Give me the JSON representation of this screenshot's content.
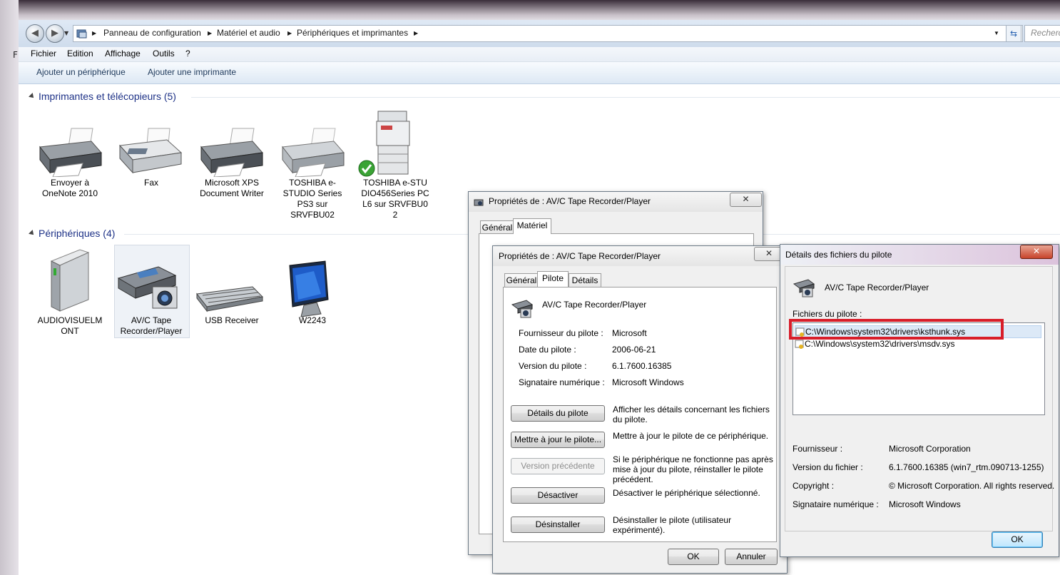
{
  "window": {
    "left_frame_letter": "F"
  },
  "addressbar": {
    "crumbs": [
      "Panneau de configuration",
      "Matériel et audio",
      "Périphériques et imprimantes"
    ],
    "search_placeholder": "Recherc"
  },
  "menu": [
    "Fichier",
    "Edition",
    "Affichage",
    "Outils",
    "?"
  ],
  "commands": [
    "Ajouter un périphérique",
    "Ajouter une imprimante"
  ],
  "groups": {
    "printers": {
      "title": "Imprimantes et télécopieurs (5)",
      "items": [
        {
          "label": "Envoyer à OneNote 2010",
          "icon": "printer-icon"
        },
        {
          "label": "Fax",
          "icon": "fax-icon"
        },
        {
          "label": "Microsoft XPS Document Writer",
          "icon": "printer-icon"
        },
        {
          "label": "TOSHIBA e-STUDIO Series PS3 sur SRVFBU02",
          "icon": "printer-icon"
        },
        {
          "label": "TOSHIBA e-STUDIO456Series PCL6 sur SRVFBU02",
          "icon": "copier-icon",
          "default": true
        }
      ]
    },
    "devices": {
      "title": "Périphériques (4)",
      "items": [
        {
          "label": "AUDIOVISUELMONT",
          "icon": "drive-icon"
        },
        {
          "label": "AV/C Tape Recorder/Player",
          "icon": "scanner-camera-icon",
          "selected": true
        },
        {
          "label": "USB Receiver",
          "icon": "keyboard-icon"
        },
        {
          "label": "W2243",
          "icon": "monitor-icon"
        }
      ]
    }
  },
  "dialog_back": {
    "title": "Propriétés de : AV/C Tape Recorder/Player",
    "tabs": [
      "Général",
      "Matériel"
    ],
    "close": "✕"
  },
  "dialog_driver": {
    "title": "Propriétés de : AV/C Tape Recorder/Player",
    "tabs": [
      "Général",
      "Pilote",
      "Détails"
    ],
    "device_name": "AV/C Tape Recorder/Player",
    "props": [
      {
        "label": "Fournisseur du pilote :",
        "value": "Microsoft"
      },
      {
        "label": "Date du pilote :",
        "value": "2006-06-21"
      },
      {
        "label": "Version du pilote :",
        "value": "6.1.7600.16385"
      },
      {
        "label": "Signataire numérique :",
        "value": "Microsoft Windows"
      }
    ],
    "actions": [
      {
        "button": "Détails du pilote",
        "desc": "Afficher les détails concernant les fichiers du pilote.",
        "enabled": true
      },
      {
        "button": "Mettre à jour le pilote...",
        "desc": "Mettre à jour le pilote de ce périphérique.",
        "enabled": true
      },
      {
        "button": "Version précédente",
        "desc": "Si le périphérique ne fonctionne pas après mise à jour du pilote, réinstaller le pilote précédent.",
        "enabled": false
      },
      {
        "button": "Désactiver",
        "desc": "Désactiver le périphérique sélectionné.",
        "enabled": true
      },
      {
        "button": "Désinstaller",
        "desc": "Désinstaller le pilote (utilisateur expérimenté).",
        "enabled": true
      }
    ],
    "ok": "OK",
    "cancel": "Annuler",
    "close": "✕"
  },
  "dialog_details": {
    "title": "Détails des fichiers du pilote",
    "device_name": "AV/C Tape Recorder/Player",
    "files_label": "Fichiers du pilote :",
    "files": [
      "C:\\Windows\\system32\\drivers\\ksthunk.sys",
      "C:\\Windows\\system32\\drivers\\msdv.sys"
    ],
    "props": [
      {
        "label": "Fournisseur :",
        "value": "Microsoft Corporation"
      },
      {
        "label": "Version du fichier :",
        "value": "6.1.7600.16385 (win7_rtm.090713-1255)"
      },
      {
        "label": "Copyright :",
        "value": "© Microsoft Corporation. All rights reserved."
      },
      {
        "label": "Signataire numérique :",
        "value": "Microsoft Windows"
      }
    ],
    "ok": "OK",
    "close": "✕",
    "highlight_color": "#d81e2a"
  }
}
